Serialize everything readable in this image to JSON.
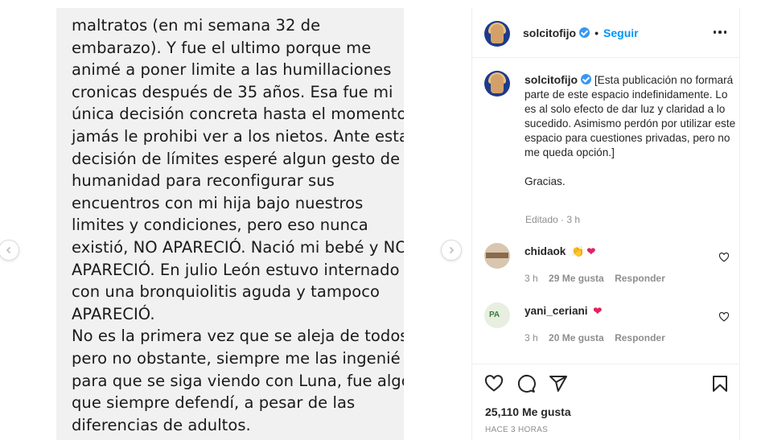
{
  "media": {
    "lines": [
      "maltratos (en mi semana 32 de",
      "embarazo). Y fue el ultimo porque me",
      "animé a poner limite a las humillaciones",
      "cronicas después de 35 años. Esa fue mi",
      "única decisión concreta hasta el momento,",
      "jamás le prohibi ver a los nietos. Ante esta",
      "decisión de límites esperé algun gesto de",
      "humanidad para reconfigurar sus",
      "encuentros con mi hija bajo nuestros",
      "limites y condiciones, pero eso nunca",
      "existió, NO APARECIÓ. Nació mi bebé y NO",
      "APARECIÓ. En julio León estuvo internado",
      "con una bronquiolitis aguda y tampoco",
      "APARECIÓ.",
      "No es la primera vez que se aleja de todos,",
      "pero no obstante, siempre me las ingenié",
      "para que se siga viendo con Luna, fue algo",
      "que siempre defendí, a pesar de las",
      "diferencias de adultos."
    ]
  },
  "header": {
    "username": "solcitofijo",
    "separator": "•",
    "follow_label": "Seguir"
  },
  "caption": {
    "username": "solcitofijo",
    "text": "[Esta publicación no formará parte de este espacio indefinidamente. Lo es al solo efecto de dar luz y claridad a lo sucedido. Asimismo perdón por utilizar este espacio para cuestiones privadas, pero no me queda opción.]",
    "thanks": "Gracias.",
    "edited": "Editado · 3 h"
  },
  "comments": [
    {
      "username": "chidaok",
      "emojis": [
        "👏",
        "❤"
      ],
      "time": "3 h",
      "likes": "29 Me gusta",
      "reply": "Responder"
    },
    {
      "username": "yani_ceriani",
      "emojis": [
        "❤"
      ],
      "time": "3 h",
      "likes": "20 Me gusta",
      "reply": "Responder",
      "avatar_text": "PA"
    }
  ],
  "actions": {
    "icons": [
      "heart-icon",
      "comment-icon",
      "share-icon",
      "bookmark-icon"
    ]
  },
  "likes": "25,110 Me gusta",
  "timestamp": "HACE 3 HORAS",
  "colors": {
    "follow": "#0095f6",
    "verified": "#3897f0",
    "heart": "#e0245e",
    "secondary_text": "#8e8e8e"
  }
}
